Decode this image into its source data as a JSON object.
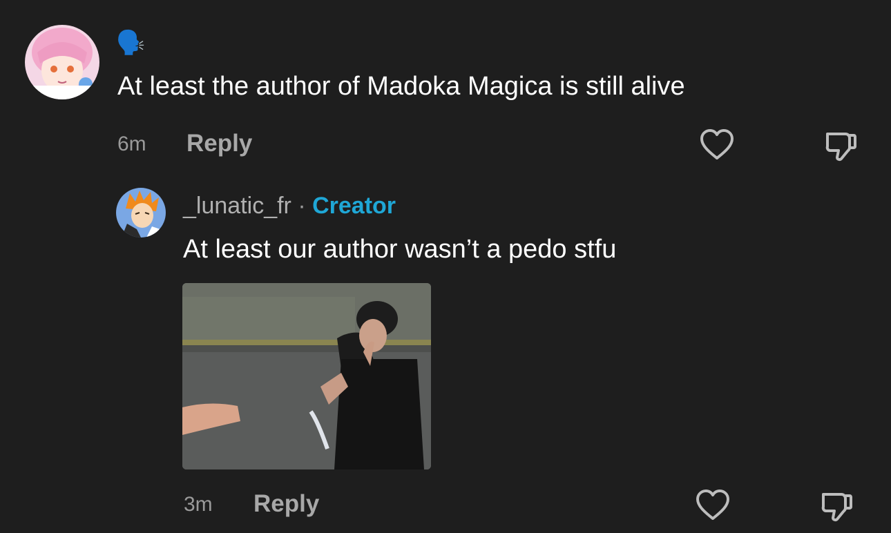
{
  "top_comment": {
    "emoji": "🗣️",
    "text": "At least the author of Madoka Magica is still alive",
    "time": "6m",
    "reply_label": "Reply",
    "avatar_icon": "anime-avatar-pink-hair",
    "like_icon": "heart-outline-icon",
    "dislike_icon": "thumbs-down-outline-icon"
  },
  "reply_comment": {
    "username": "_lunatic_fr",
    "separator": "·",
    "badge": "Creator",
    "text": "At least our author wasn’t a pedo stfu",
    "time": "3m",
    "reply_label": "Reply",
    "avatar_icon": "anime-avatar-orange-hair",
    "attachment": "gif-image",
    "like_icon": "heart-outline-icon",
    "dislike_icon": "thumbs-down-outline-icon"
  },
  "colors": {
    "background": "#1e1e1e",
    "text_primary": "#ffffff",
    "text_secondary": "#a8a8a8",
    "creator_badge": "#1fa7d6"
  }
}
